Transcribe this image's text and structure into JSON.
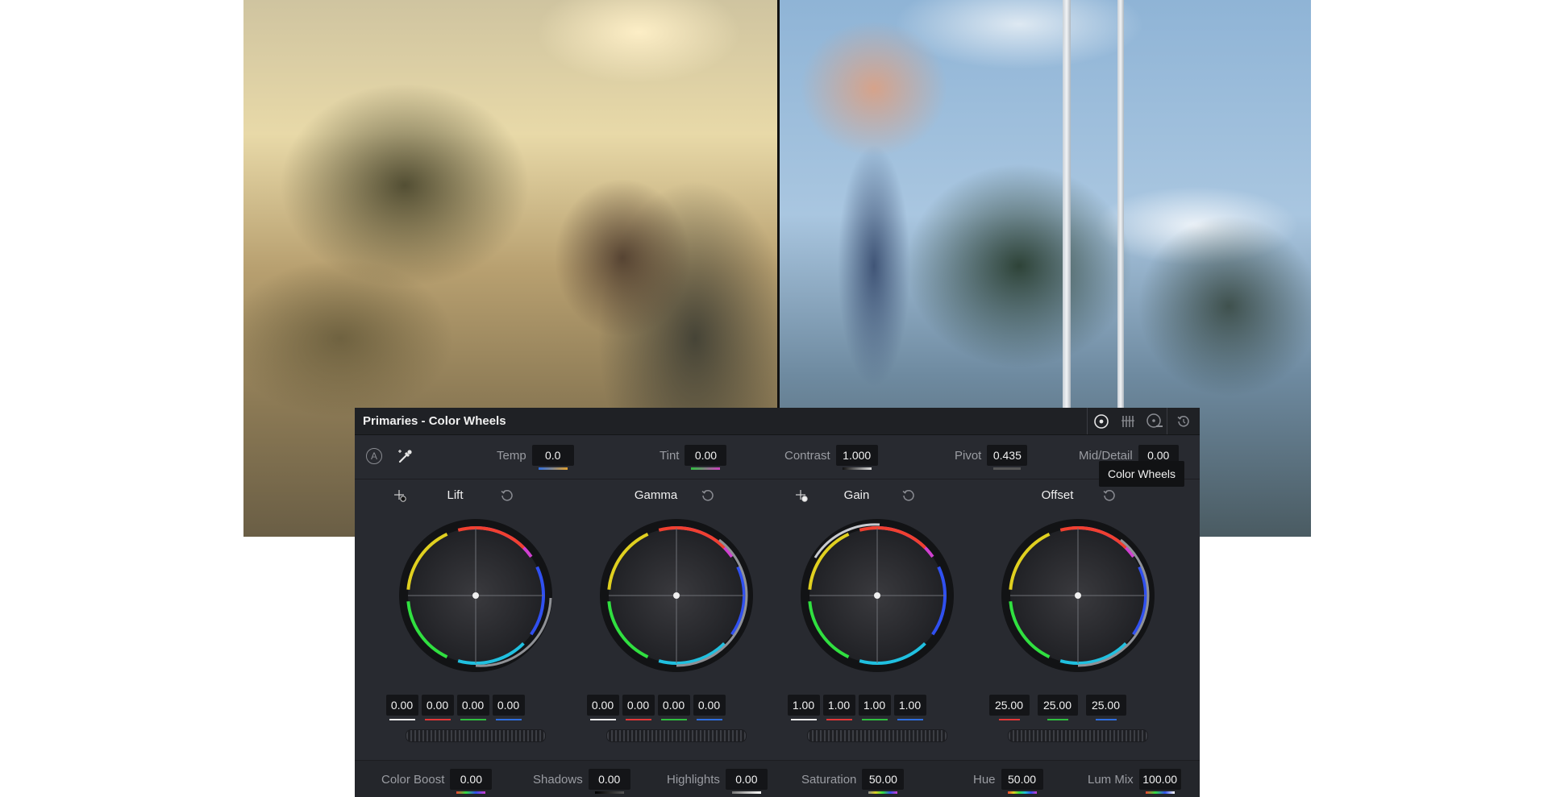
{
  "panel": {
    "title": "Primaries - Color Wheels",
    "modes": [
      {
        "icon": "color-wheels-mode-icon",
        "active": true
      },
      {
        "icon": "primaries-bars-mode-icon",
        "active": false
      },
      {
        "icon": "log-wheels-mode-icon",
        "active": false
      }
    ],
    "reset_icon": "reset-all-icon"
  },
  "top_params": {
    "auto_label": "A",
    "temp": {
      "label": "Temp",
      "value": "0.0"
    },
    "tint": {
      "label": "Tint",
      "value": "0.00"
    },
    "contrast": {
      "label": "Contrast",
      "value": "1.000"
    },
    "pivot": {
      "label": "Pivot",
      "value": "0.435"
    },
    "mid_detail": {
      "label": "Mid/Detail",
      "value": "0.00"
    }
  },
  "wheels": [
    {
      "name": "Lift",
      "values": [
        "0.00",
        "0.00",
        "0.00",
        "0.00"
      ]
    },
    {
      "name": "Gamma",
      "values": [
        "0.00",
        "0.00",
        "0.00",
        "0.00"
      ]
    },
    {
      "name": "Gain",
      "values": [
        "1.00",
        "1.00",
        "1.00",
        "1.00"
      ]
    },
    {
      "name": "Offset",
      "values": [
        "25.00",
        "25.00",
        "25.00"
      ]
    }
  ],
  "bottom_params": {
    "color_boost": {
      "label": "Color Boost",
      "value": "0.00"
    },
    "shadows": {
      "label": "Shadows",
      "value": "0.00"
    },
    "highlights": {
      "label": "Highlights",
      "value": "0.00"
    },
    "saturation": {
      "label": "Saturation",
      "value": "50.00"
    },
    "hue": {
      "label": "Hue",
      "value": "50.00"
    },
    "lum_mix": {
      "label": "Lum Mix",
      "value": "100.00"
    }
  },
  "tooltip": "Color Wheels",
  "colors": {
    "panel_bg": "#282a30",
    "header_bg": "#1f2125",
    "field_bg": "#141518",
    "red": "#e23838",
    "green": "#2fbf3f",
    "blue": "#2f6fe0",
    "white": "#f0f0f0"
  }
}
